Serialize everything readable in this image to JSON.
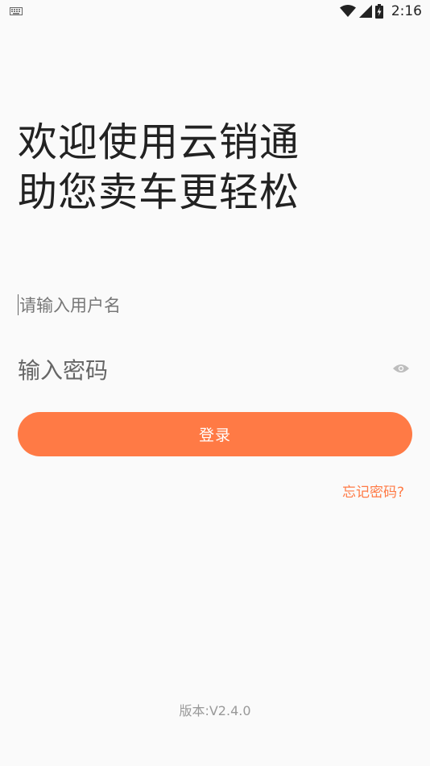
{
  "status_bar": {
    "time": "2:16",
    "keyboard_icon": "keyboard-icon",
    "wifi_icon": "wifi-icon",
    "signal_icon": "signal-icon",
    "battery_icon": "battery-charging-icon"
  },
  "headline": {
    "line1": "欢迎使用云销通",
    "line2": "助您卖车更轻松"
  },
  "login_form": {
    "username_placeholder": "请输入用户名",
    "username_value": "",
    "password_placeholder": "输入密码",
    "password_value": "",
    "password_toggle_icon": "eye-icon",
    "login_label": "登录",
    "forgot_password_label": "忘记密码?"
  },
  "footer": {
    "version": "版本:V2.4.0"
  },
  "colors": {
    "accent": "#ff7a45",
    "background": "#fafafa",
    "text_primary": "#222222",
    "text_secondary": "#999999"
  }
}
